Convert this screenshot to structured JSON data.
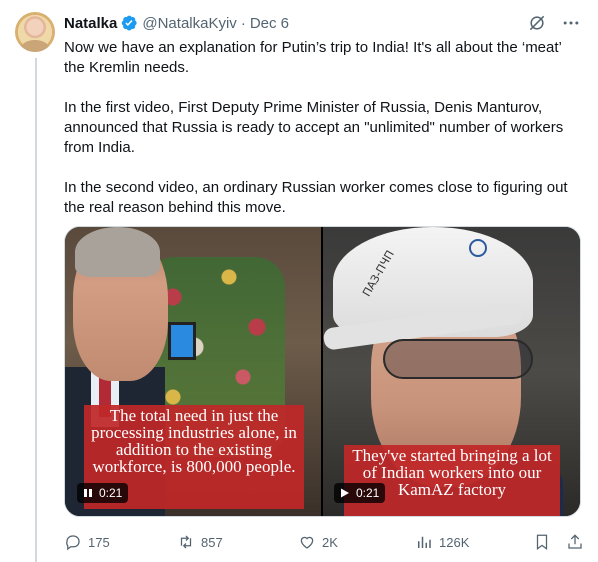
{
  "tweet": {
    "author_name": "Natalka",
    "handle": "@NatalkaKyiv",
    "separator": "·",
    "date": "Dec 6",
    "paragraphs": [
      "Now we have an explanation for Putin’s trip to India! It's all about the ‘meat’ the Kremlin needs.",
      "In the first video, First Deputy Prime Minister of Russia, Denis Manturov, announced that Russia is ready to accept an \"unlimited\" number of workers from India.",
      "In the second video, an ordinary Russian worker comes close to figuring out the real reason behind this move."
    ]
  },
  "videos": [
    {
      "caption": "The total need in just the processing industries alone, in addition to the existing workforce, is 800,000 people.",
      "duration": "0:21",
      "state_icon": "pause-icon"
    },
    {
      "caption": "They've started bringing a lot of Indian workers into our KamAZ factory",
      "duration": "0:21",
      "state_icon": "play-icon",
      "helmet_text": "ПАЗ-ПЧП"
    }
  ],
  "actions": {
    "replies": "175",
    "reposts": "857",
    "likes": "2K",
    "views": "126K"
  },
  "colors": {
    "verified": "#1d9bf0",
    "muted_text": "#536471",
    "caption_bg": "#c02828"
  }
}
